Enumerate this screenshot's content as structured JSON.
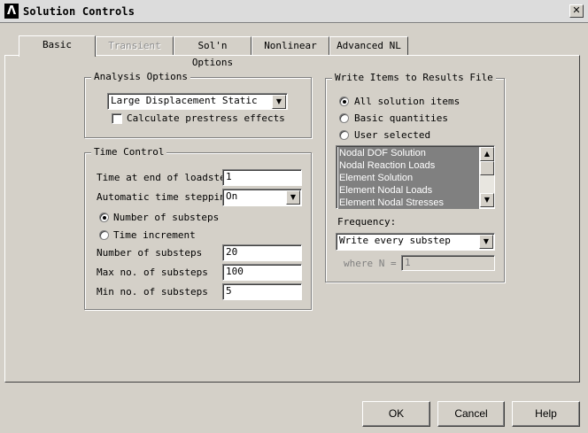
{
  "window": {
    "title": "Solution Controls",
    "logo_glyph": "Λ",
    "close_glyph": "✕"
  },
  "tabs": [
    {
      "label": "Basic"
    },
    {
      "label": "Transient"
    },
    {
      "label": "Sol'n Options"
    },
    {
      "label": "Nonlinear"
    },
    {
      "label": "Advanced NL"
    }
  ],
  "analysis_options": {
    "legend": "Analysis Options",
    "analysis_type": "Large Displacement Static",
    "prestress_label": "Calculate prestress effects",
    "prestress_checked": false
  },
  "time_control": {
    "legend": "Time Control",
    "time_end_label": "Time at end of loadstep",
    "time_end_value": "1",
    "auto_step_label": "Automatic time stepping",
    "auto_step_value": "On",
    "radio_substeps": "Number of substeps",
    "radio_increment": "Time increment",
    "selected": "substeps",
    "num_substeps_label": "Number of substeps",
    "num_substeps_value": "20",
    "max_substeps_label": "Max no. of substeps",
    "max_substeps_value": "100",
    "min_substeps_label": "Min no. of substeps",
    "min_substeps_value": "5"
  },
  "write_items": {
    "legend": "Write Items to Results File",
    "radio_all": "All solution items",
    "radio_basic": "Basic quantities",
    "radio_user": "User selected",
    "selected": "all",
    "list_items": [
      "Nodal DOF Solution",
      "Nodal Reaction Loads",
      "Element Solution",
      "Element Nodal Loads",
      "Element Nodal Stresses"
    ],
    "frequency_label": "Frequency:",
    "frequency_value": "Write every substep",
    "where_label": "where N =",
    "where_value": "1"
  },
  "buttons": {
    "ok": "OK",
    "cancel": "Cancel",
    "help": "Help"
  },
  "icons": {
    "dropdown": "▼",
    "scroll_up": "▲",
    "scroll_down": "▼"
  }
}
